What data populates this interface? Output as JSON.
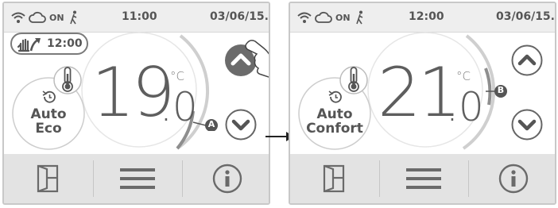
{
  "screen1": {
    "status": {
      "on_label": "ON",
      "time": "11:00",
      "date": "03/06/15."
    },
    "manual_override_time": "12:00",
    "temperature": {
      "integer": "19",
      "decimal": ".0",
      "unit": "°C"
    },
    "mode": {
      "line1": "Auto",
      "line2": "Eco"
    },
    "callout": "A"
  },
  "screen2": {
    "status": {
      "on_label": "ON",
      "time": "12:00",
      "date": "03/06/15."
    },
    "temperature": {
      "integer": "21",
      "decimal": ".0",
      "unit": "°C"
    },
    "mode": {
      "line1": "Auto",
      "line2": "Confort"
    },
    "callout": "B"
  },
  "icons": {
    "status": [
      "wifi-icon",
      "cloud-icon",
      "walking-person-icon"
    ],
    "nav": [
      "door-icon",
      "menu-icon",
      "info-icon"
    ],
    "other": [
      "thermometer-icon",
      "clock-icon",
      "hand-arrow-icon",
      "chevron-up-icon",
      "chevron-down-icon",
      "pointing-hand-icon",
      "arrow-right-icon"
    ]
  },
  "colors": {
    "ring": "#c9c9c9",
    "dark_button": "#6b6b6b",
    "bottombar": "#e3e3e3",
    "statusbar": "#eeeeee"
  }
}
